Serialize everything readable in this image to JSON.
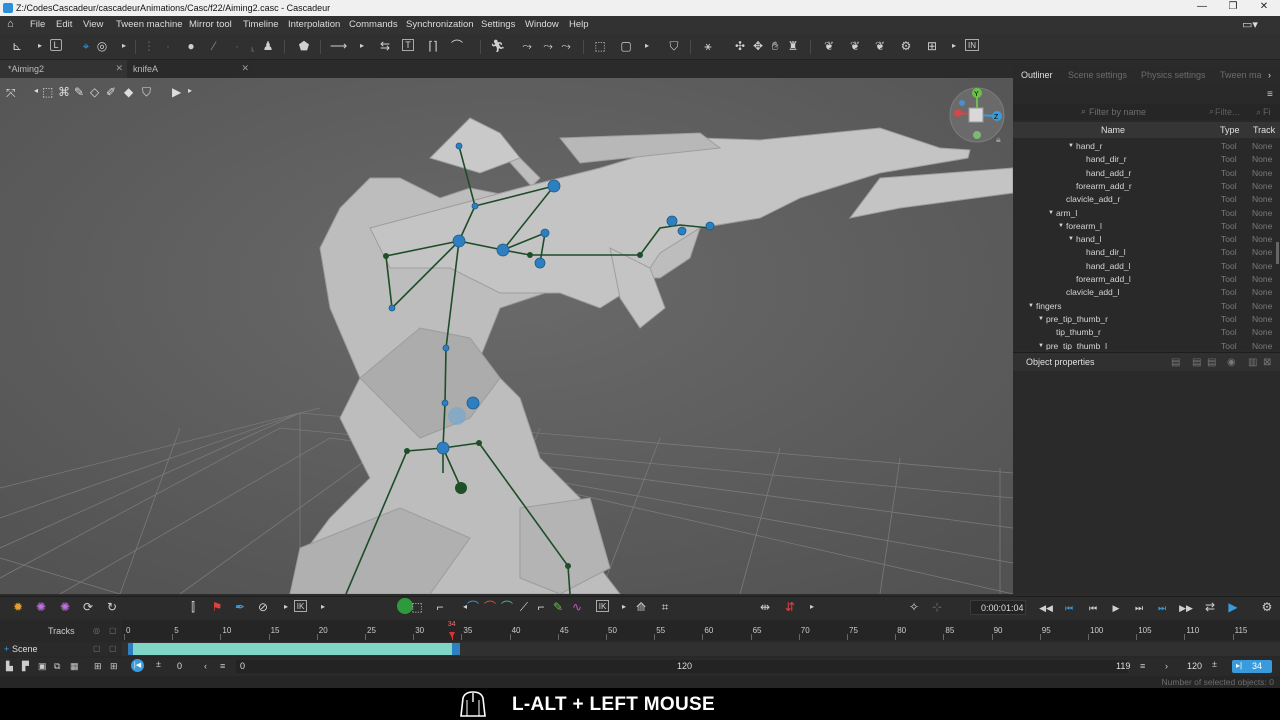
{
  "window": {
    "title": "Z:/CodesCascadeur/cascadeurAnimations/Casc/f22/Aiming2.casc - Cascadeur",
    "minimize": "—",
    "maximize": "❐",
    "close": "✕"
  },
  "menu": [
    "File",
    "Edit",
    "View",
    "Tween machine",
    "Mirror tool",
    "Timeline",
    "Interpolation",
    "Commands",
    "Synchronization",
    "Settings",
    "Window",
    "Help"
  ],
  "doc_tabs": [
    {
      "label": "*Aiming2",
      "active": true
    },
    {
      "label": "knifeA",
      "active": false
    }
  ],
  "panel_tabs": [
    "Outliner",
    "Scene settings",
    "Physics settings",
    "Tween ma"
  ],
  "outliner": {
    "filter_placeholder": "Filter by name",
    "filter_type_placeholder": "Filte...",
    "columns": {
      "name": "Name",
      "type": "Type",
      "track": "Track"
    },
    "rows": [
      {
        "name": "hand_r",
        "indent": 4,
        "arrow": true,
        "type": "Tool",
        "track": "None"
      },
      {
        "name": "hand_dir_r",
        "indent": 5,
        "arrow": false,
        "type": "Tool",
        "track": "None"
      },
      {
        "name": "hand_add_r",
        "indent": 5,
        "arrow": false,
        "type": "Tool",
        "track": "None"
      },
      {
        "name": "forearm_add_r",
        "indent": 4,
        "arrow": false,
        "type": "Tool",
        "track": "None"
      },
      {
        "name": "clavicle_add_r",
        "indent": 3,
        "arrow": false,
        "type": "Tool",
        "track": "None"
      },
      {
        "name": "arm_l",
        "indent": 2,
        "arrow": true,
        "type": "Tool",
        "track": "None"
      },
      {
        "name": "forearm_l",
        "indent": 3,
        "arrow": true,
        "type": "Tool",
        "track": "None"
      },
      {
        "name": "hand_l",
        "indent": 4,
        "arrow": true,
        "type": "Tool",
        "track": "None"
      },
      {
        "name": "hand_dir_l",
        "indent": 5,
        "arrow": false,
        "type": "Tool",
        "track": "None"
      },
      {
        "name": "hand_add_l",
        "indent": 5,
        "arrow": false,
        "type": "Tool",
        "track": "None"
      },
      {
        "name": "forearm_add_l",
        "indent": 4,
        "arrow": false,
        "type": "Tool",
        "track": "None"
      },
      {
        "name": "clavicle_add_l",
        "indent": 3,
        "arrow": false,
        "type": "Tool",
        "track": "None"
      },
      {
        "name": "fingers",
        "indent": 0,
        "arrow": true,
        "type": "Tool",
        "track": "None"
      },
      {
        "name": "pre_tip_thumb_r",
        "indent": 1,
        "arrow": true,
        "type": "Tool",
        "track": "None"
      },
      {
        "name": "tip_thumb_r",
        "indent": 2,
        "arrow": false,
        "type": "Tool",
        "track": "None"
      },
      {
        "name": "pre_tip_thumb_l",
        "indent": 1,
        "arrow": true,
        "type": "Tool",
        "track": "None"
      }
    ]
  },
  "object_properties": {
    "title": "Object properties"
  },
  "timeline": {
    "tracks_label": "Tracks",
    "scene_label": "Scene",
    "time_display": "0:00:01:04",
    "ticks": [
      "0",
      "5",
      "10",
      "15",
      "20",
      "25",
      "30",
      "35",
      "40",
      "45",
      "50",
      "55",
      "60",
      "65",
      "70",
      "75",
      "80",
      "85",
      "90",
      "95",
      "100",
      "105",
      "110",
      "115"
    ],
    "current_frame": "34",
    "range_start": "0",
    "range_end_field": "0",
    "range_mid": "120",
    "frame_count_left": "119",
    "frame_count_right": "120",
    "frame_field": "34"
  },
  "status": {
    "selected": "Number of selected objects: 0"
  },
  "caption": {
    "text": "L-ALT + LEFT MOUSE"
  },
  "colors": {
    "accent": "#3a9bdc",
    "scene_bar": "#7fd6c6",
    "joint": "#2e7fc0",
    "bone": "#1d4d28"
  }
}
